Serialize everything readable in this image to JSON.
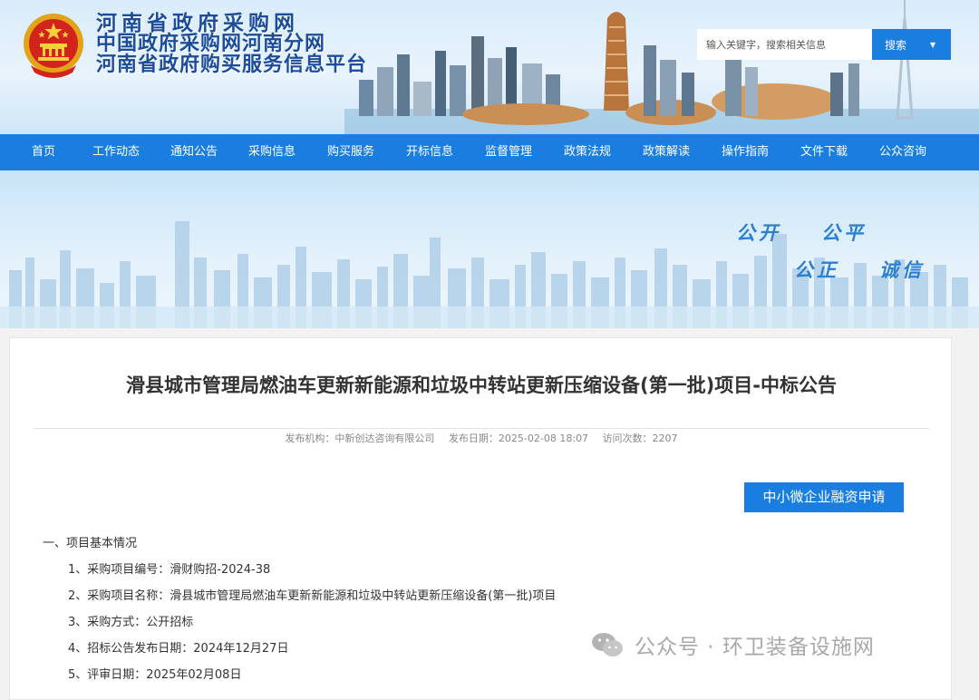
{
  "header": {
    "titles": [
      "河南省政府采购网",
      "中国政府采购网河南分网",
      "河南省政府购买服务信息平台"
    ],
    "search": {
      "placeholder": "输入关键字，搜索相关信息",
      "button_label": "搜索"
    }
  },
  "nav": {
    "items": [
      "首页",
      "工作动态",
      "通知公告",
      "采购信息",
      "购买服务",
      "开标信息",
      "监督管理",
      "政策法规",
      "政策解读",
      "操作指南",
      "文件下载",
      "公众咨询"
    ]
  },
  "banner": {
    "slogans": [
      "公开",
      "公平",
      "公正",
      "诚信"
    ]
  },
  "article": {
    "title": "滑县城市管理局燃油车更新新能源和垃圾中转站更新压缩设备(第一批)项目-中标公告",
    "meta": {
      "publisher": "发布机构：中新创达咨询有限公司",
      "date": "发布日期：2025-02-08 18:07",
      "views": "访问次数：2207"
    },
    "finance_button": "中小微企业融资申请",
    "section_title": "一、项目基本情况",
    "items": [
      "1、采购项目编号：滑财购招-2024-38",
      "2、采购项目名称：滑县城市管理局燃油车更新新能源和垃圾中转站更新压缩设备(第一批)项目",
      "3、采购方式：公开招标",
      "4、招标公告发布日期：2024年12月27日",
      "5、评审日期：2025年02月08日"
    ]
  },
  "watermark": {
    "text": "公众号 · 环卫装备设施网"
  },
  "colors": {
    "nav_blue": "#1a7ee0",
    "title_blue": "#1d4d9a",
    "slogan_blue": "#2d7fd0"
  }
}
